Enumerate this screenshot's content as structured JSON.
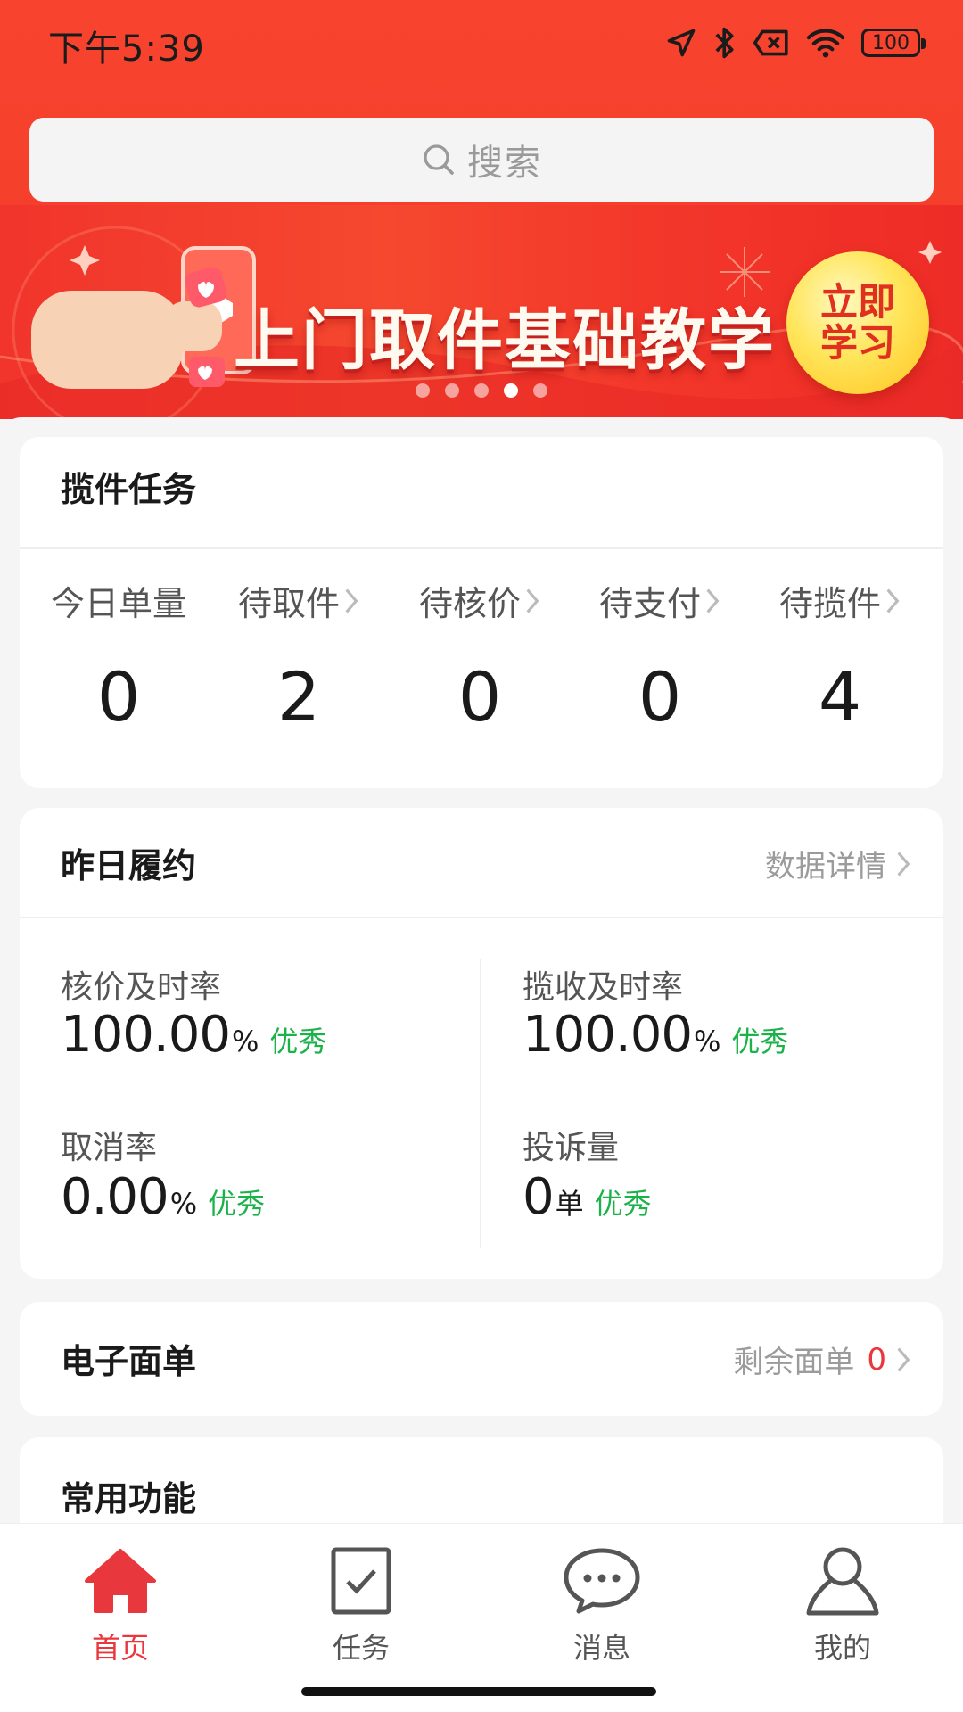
{
  "status_bar": {
    "time": "下午5:39",
    "battery": "100"
  },
  "search": {
    "placeholder": "搜索"
  },
  "banner": {
    "title": "上门取件基础教学",
    "button": "立即学习",
    "dots_total": 5,
    "active_dot": 4
  },
  "pickup_tasks": {
    "title": "揽件任务",
    "items": [
      {
        "label": "今日单量",
        "value": "0",
        "has_chevron": false
      },
      {
        "label": "待取件",
        "value": "2",
        "has_chevron": true
      },
      {
        "label": "待核价",
        "value": "0",
        "has_chevron": true
      },
      {
        "label": "待支付",
        "value": "0",
        "has_chevron": true
      },
      {
        "label": "待揽件",
        "value": "4",
        "has_chevron": true
      }
    ]
  },
  "fulfillment": {
    "title": "昨日履约",
    "link": "数据详情",
    "metrics": [
      {
        "label": "核价及时率",
        "value": "100.00",
        "unit": "%",
        "grade": "优秀"
      },
      {
        "label": "揽收及时率",
        "value": "100.00",
        "unit": "%",
        "grade": "优秀"
      },
      {
        "label": "取消率",
        "value": "0.00",
        "unit": "%",
        "grade": "优秀"
      },
      {
        "label": "投诉量",
        "value": "0",
        "unit": "单",
        "grade": "优秀"
      }
    ]
  },
  "waybill": {
    "title": "电子面单",
    "remaining_label": "剩余面单",
    "remaining_value": "0"
  },
  "common": {
    "title": "常用功能"
  },
  "tabbar": {
    "tabs": [
      {
        "label": "首页",
        "icon": "home-icon",
        "active": true
      },
      {
        "label": "任务",
        "icon": "task-icon",
        "active": false
      },
      {
        "label": "消息",
        "icon": "message-icon",
        "active": false
      },
      {
        "label": "我的",
        "icon": "profile-icon",
        "active": false
      }
    ]
  },
  "colors": {
    "brand_red": "#f5402c",
    "accent_red": "#e8383d",
    "good_green": "#1bb24a"
  }
}
